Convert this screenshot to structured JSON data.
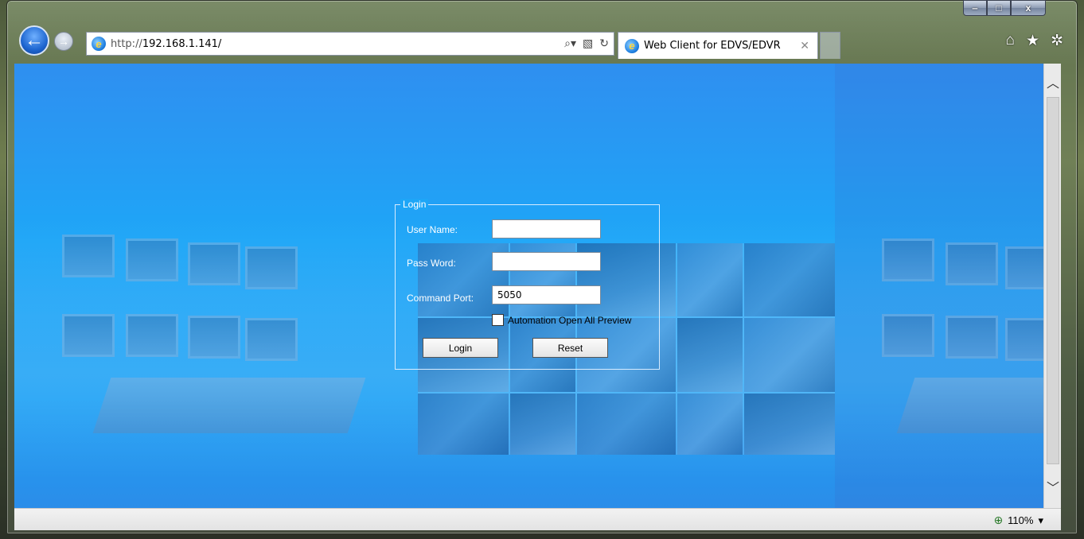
{
  "browser": {
    "url_prefix": "http://",
    "url_host": "192.168.1.141/",
    "tab_title": "Web Client for EDVS/EDVR",
    "zoom_level": "110%"
  },
  "window_controls": {
    "minimize": "‒",
    "maximize": "□",
    "close": "x"
  },
  "login": {
    "legend": "Login",
    "username_label": "User Name:",
    "username_value": "",
    "password_label": "Pass Word:",
    "password_value": "",
    "port_label": "Command Port:",
    "port_value": "5050",
    "automation_label": "Automation Open All Preview",
    "automation_checked": false,
    "login_button": "Login",
    "reset_button": "Reset"
  },
  "colors": {
    "page_bg": "#1ea6f7",
    "back_button": "#1e66d0"
  },
  "icons": [
    "back-arrow-icon",
    "forward-arrow-icon",
    "ie-logo-icon",
    "search-icon",
    "compatibility-icon",
    "refresh-icon",
    "tab-close-icon",
    "home-icon",
    "favorites-star-icon",
    "tools-gear-icon",
    "zoom-icon",
    "chevron-up-icon",
    "chevron-down-icon"
  ]
}
